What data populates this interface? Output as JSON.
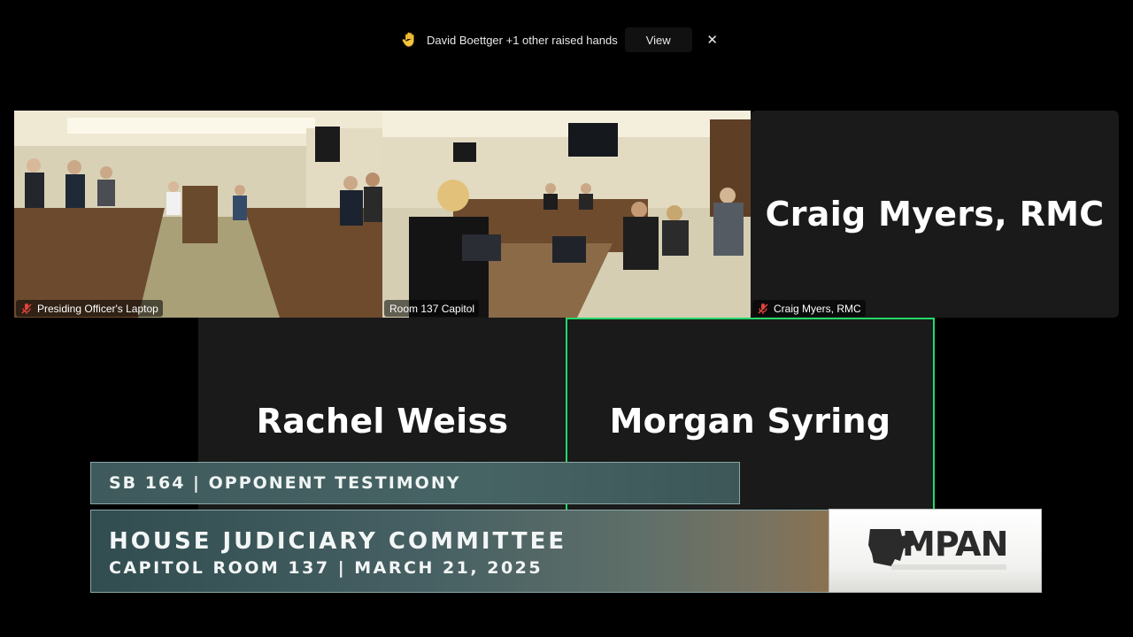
{
  "raised_hands": {
    "message": "David Boettger +1 other raised hands",
    "view_label": "View",
    "close_symbol": "✕",
    "icon": "raised-hand-icon"
  },
  "tiles": [
    {
      "label": "Presiding Officer's Laptop",
      "muted": true
    },
    {
      "label": "Room 137 Capitol",
      "muted": false
    },
    {
      "label": "Craig Myers, RMC",
      "display_name": "Craig Myers, RMC",
      "muted": true
    },
    {
      "display_name": "Rachel Weiss"
    },
    {
      "display_name": "Morgan Syring",
      "active_speaker": true
    }
  ],
  "lower_third": {
    "bill": "SB 164 | OPPONENT TESTIMONY",
    "committee": "HOUSE JUDICIARY COMMITTEE",
    "location_date": "CAPITOL ROOM 137 | MARCH 21, 2025",
    "logo_text": "MPAN"
  },
  "colors": {
    "active_speaker_border": "#23d96b",
    "muted_icon": "#e0433c",
    "banner": "#476465"
  }
}
